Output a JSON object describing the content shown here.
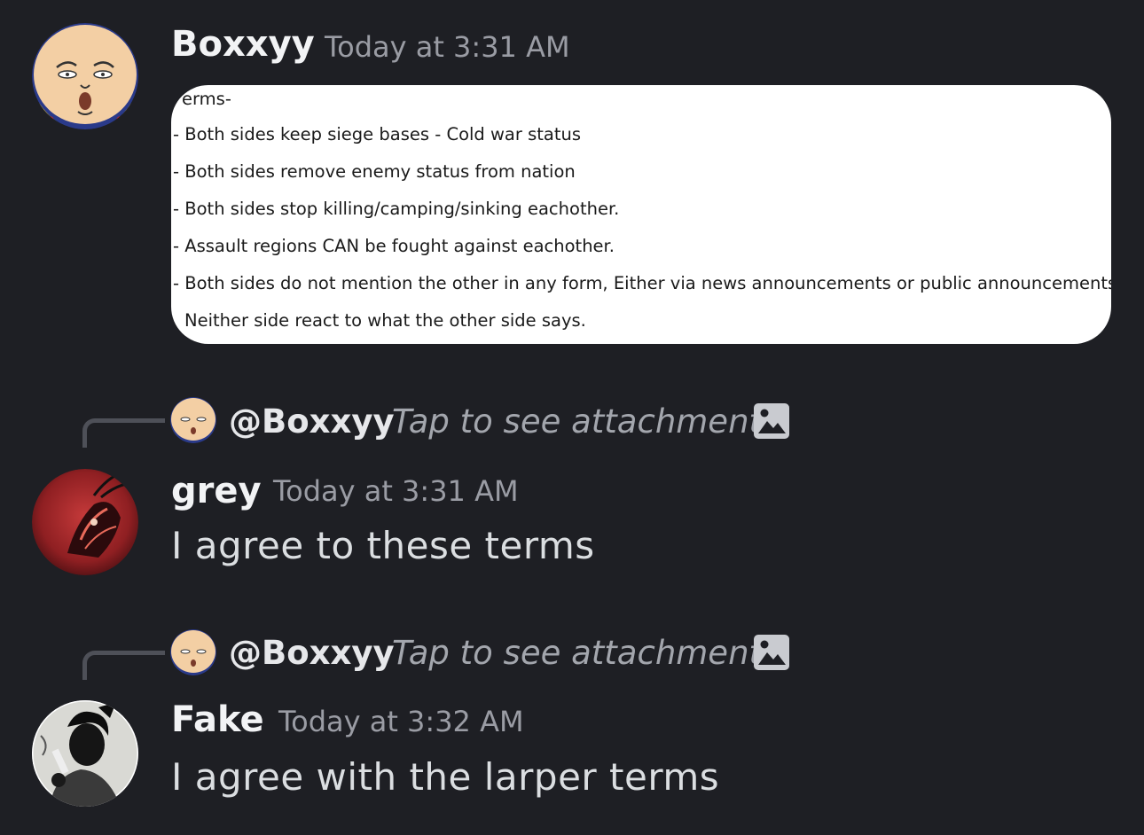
{
  "messages": [
    {
      "author": "Boxxyy",
      "timestamp": "Today at 3:31 AM",
      "avatar_icon": "bald-cartoon-face-avatar",
      "attachment_lines": [
        "erms-",
        "- Both sides keep siege bases - Cold war status",
        "- Both sides remove enemy status from nation",
        "- Both sides stop killing/camping/sinking eachother.",
        "- Assault regions CAN be fought against eachother.",
        "- Both sides do not mention the other in any form, Either via news announcements or public announcements.",
        "Neither side react to what the other side says."
      ]
    },
    {
      "reply": {
        "mention": "@Boxxyy",
        "text": "Tap to see attachment",
        "icon": "image-icon"
      },
      "author": "grey",
      "timestamp": "Today at 3:31 AM",
      "avatar_icon": "red-creature-avatar",
      "text": "I agree to these terms"
    },
    {
      "reply": {
        "mention": "@Boxxyy",
        "text": "Tap to see attachment",
        "icon": "image-icon"
      },
      "author": "Fake",
      "timestamp": "Today at 3:32 AM",
      "avatar_icon": "monochrome-portrait-avatar",
      "text": "I agree with the larper terms"
    }
  ],
  "colors": {
    "background": "#1e1f24",
    "author": "#f2f3f5",
    "timestamp": "#9a9ca4",
    "message_text": "#dbdee1",
    "reply_text": "#a3a6ad",
    "reply_line": "#4e5058"
  }
}
